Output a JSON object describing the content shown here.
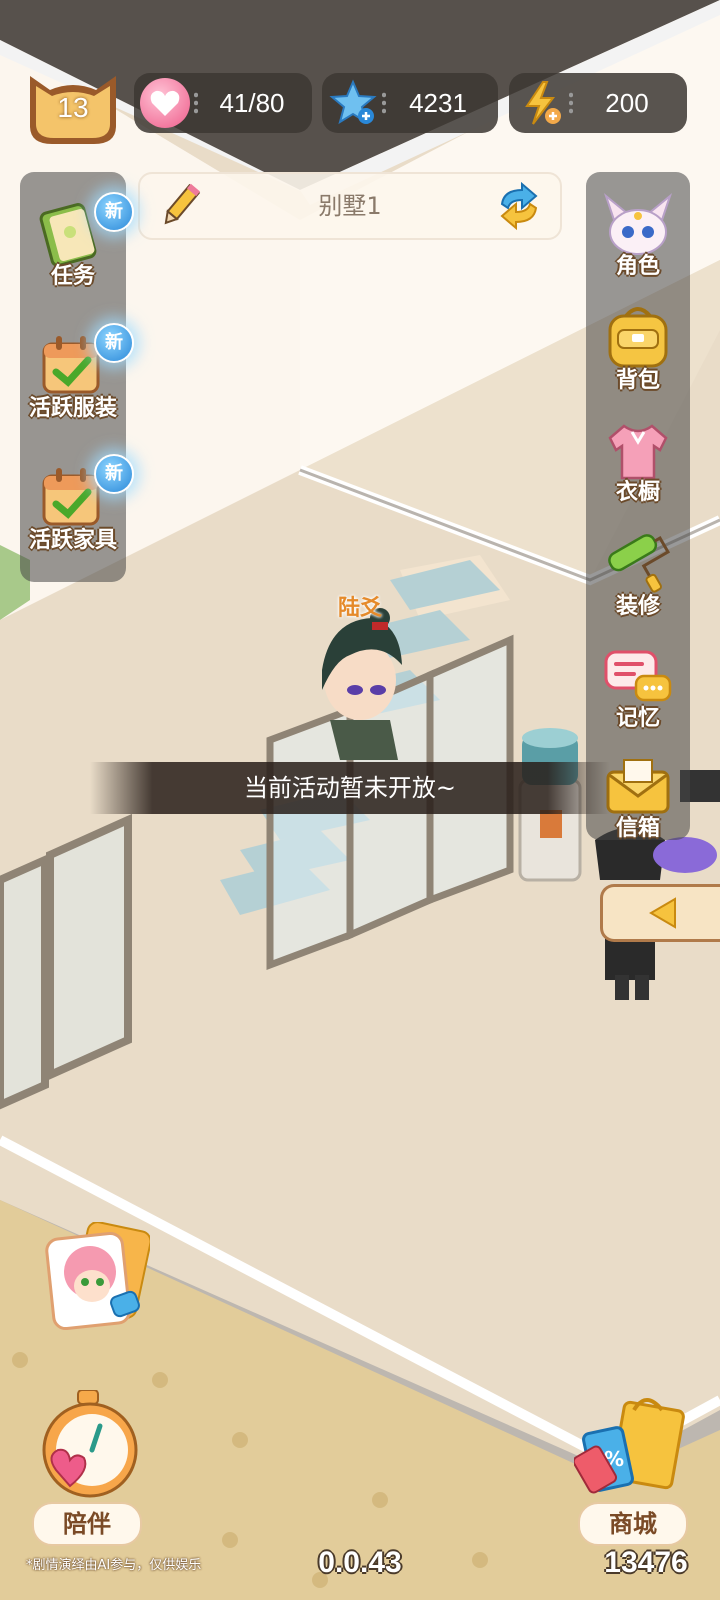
{
  "level": {
    "value": "13"
  },
  "resources": [
    {
      "icon": "heart-icon",
      "value": "41/80"
    },
    {
      "icon": "star-icon",
      "value": "4231"
    },
    {
      "icon": "lightning-icon",
      "value": "200"
    }
  ],
  "room": {
    "name": "别墅1"
  },
  "left_menu": [
    {
      "label": "任务",
      "icon": "book-icon",
      "badge": "新"
    },
    {
      "label": "活跃服装",
      "icon": "calendar-check-icon",
      "badge": "新"
    },
    {
      "label": "活跃家具",
      "icon": "calendar-check-icon",
      "badge": "新"
    }
  ],
  "right_menu": [
    {
      "label": "角色",
      "icon": "fox-icon"
    },
    {
      "label": "背包",
      "icon": "backpack-icon"
    },
    {
      "label": "衣橱",
      "icon": "shirt-icon"
    },
    {
      "label": "装修",
      "icon": "paint-roller-icon"
    },
    {
      "label": "记忆",
      "icon": "chat-bubble-icon"
    },
    {
      "label": "信箱",
      "icon": "envelope-icon"
    }
  ],
  "character": {
    "name": "陆爻"
  },
  "toast": {
    "text": "当前活动暂未开放~"
  },
  "bottom": {
    "companion_label": "陪伴",
    "shop_label": "商城",
    "disclaimer": "*剧情演绎由AI参与，仅供娱乐",
    "version": "0.0.43",
    "currency": "13476"
  },
  "colors": {
    "accent": "#f3a94a",
    "panel": "#4a4a4a",
    "badge": "#2a88d8"
  }
}
